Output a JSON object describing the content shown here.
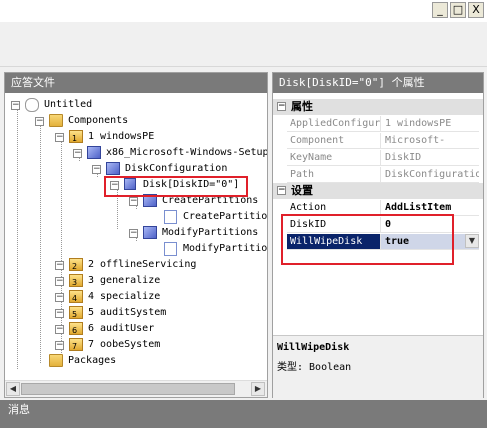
{
  "window": {
    "minimize_glyph": "_",
    "maximize_glyph": "□",
    "close_glyph": "X"
  },
  "left_pane": {
    "title": "应答文件",
    "tree": [
      {
        "label": "Untitled",
        "icon": "answer-file-icon"
      },
      {
        "label": "Components",
        "icon": "folder-icon"
      },
      {
        "label": "1 windowsPE",
        "icon": "pass-icon",
        "num": "1"
      },
      {
        "label": "x86_Microsoft-Windows-Setup_",
        "icon": "component-icon"
      },
      {
        "label": "DiskConfiguration",
        "icon": "component-icon"
      },
      {
        "label": "Disk[DiskID=\"0\"]",
        "icon": "list-item-icon"
      },
      {
        "label": "CreatePartitions",
        "icon": "component-icon"
      },
      {
        "label": "CreatePartition",
        "icon": "setting-icon"
      },
      {
        "label": "ModifyPartitions",
        "icon": "component-icon"
      },
      {
        "label": "ModifyPartition",
        "icon": "setting-icon"
      },
      {
        "label": "2 offlineServicing",
        "icon": "pass-icon",
        "num": "2"
      },
      {
        "label": "3 generalize",
        "icon": "pass-icon",
        "num": "3"
      },
      {
        "label": "4 specialize",
        "icon": "pass-icon",
        "num": "4"
      },
      {
        "label": "5 auditSystem",
        "icon": "pass-icon",
        "num": "5"
      },
      {
        "label": "6 auditUser",
        "icon": "pass-icon",
        "num": "6"
      },
      {
        "label": "7 oobeSystem",
        "icon": "pass-icon",
        "num": "7"
      },
      {
        "label": "Packages",
        "icon": "folder-icon"
      }
    ]
  },
  "right_pane": {
    "title": "Disk[DiskID=\"0\"] 个属性",
    "category_properties": "属性",
    "properties": [
      {
        "name": "AppliedConfigur",
        "value": "1 windowsPE"
      },
      {
        "name": "Component",
        "value": "Microsoft-Window"
      },
      {
        "name": "KeyName",
        "value": "DiskID"
      },
      {
        "name": "Path",
        "value": "DiskConfiguratio"
      }
    ],
    "category_settings": "设置",
    "settings": [
      {
        "name": "Action",
        "value": "AddListItem"
      },
      {
        "name": "DiskID",
        "value": "0"
      },
      {
        "name": "WillWipeDisk",
        "value": "true"
      }
    ],
    "help_title": "WillWipeDisk",
    "help_type": "类型: Boolean"
  },
  "messages": {
    "title": "消息"
  }
}
